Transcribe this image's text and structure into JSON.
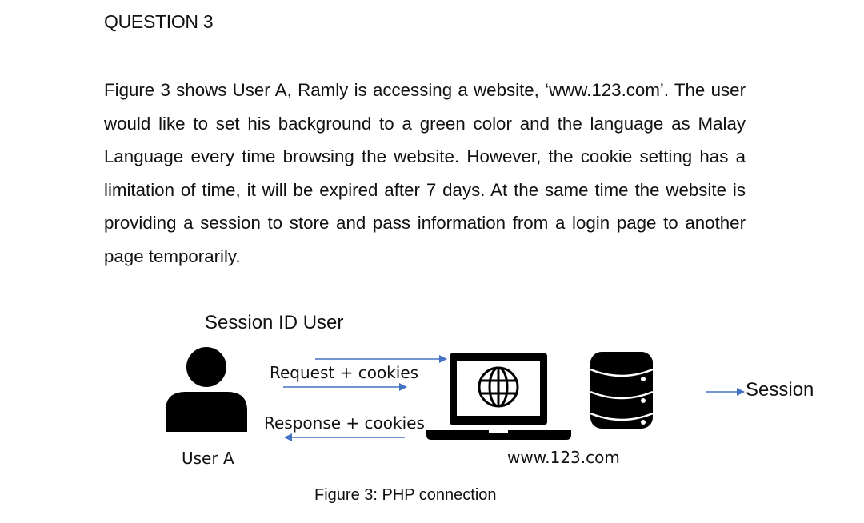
{
  "question": {
    "heading": "QUESTION 3",
    "paragraph": "Figure 3 shows User A, Ramly is accessing a website, ‘www.123.com’. The user would like to set his background to a green color and the language as Malay Language every time browsing the website. However, the cookie setting has a limitation of time, it will be expired after 7 days. At the same time the website is providing a session to store and pass information from a login page to another page temporarily."
  },
  "figure": {
    "session_id_label": "Session ID User",
    "request_label": "Request + cookies",
    "response_label": "Response + cookies",
    "user_label": "User A",
    "website_label": "www.123.com",
    "legend_label": "Session",
    "caption": "Figure 3: PHP connection",
    "icons": [
      "user-icon",
      "laptop-icon",
      "globe-icon",
      "database-icon"
    ],
    "arrow_color": "#4472C4"
  }
}
